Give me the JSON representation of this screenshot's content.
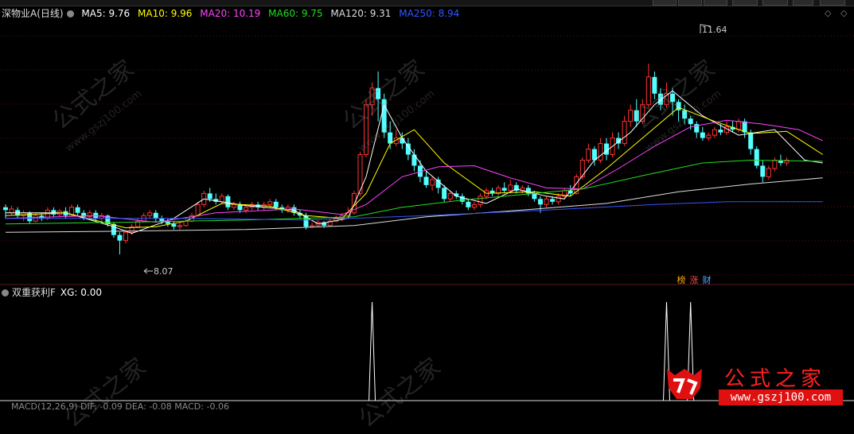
{
  "stock_legend": {
    "name": "深物业A(日线)",
    "ma": [
      {
        "label": "MA5: 9.76",
        "color": "#ffffff"
      },
      {
        "label": "MA10: 9.96",
        "color": "#ffff00"
      },
      {
        "label": "MA20: 10.19",
        "color": "#ff44ff"
      },
      {
        "label": "MA60: 9.75",
        "color": "#22dd22"
      },
      {
        "label": "MA120: 9.31",
        "color": "#dddddd"
      },
      {
        "label": "MA250: 8.94",
        "color": "#3355ff"
      }
    ]
  },
  "indicator_legend": {
    "name": "双重获利F",
    "value": "XG: 0.00"
  },
  "macd_legend": {
    "text": "MACD(12,26,9)  DIF: -0.09  DEA: -0.08  MACD: -0.06"
  },
  "price_annotations": {
    "high": "11.64",
    "low": "8.07"
  },
  "badges": [
    {
      "char": "榜",
      "color": "#ffaa00"
    },
    {
      "char": "涨",
      "color": "#ff4444"
    },
    {
      "char": "财",
      "color": "#55aaff"
    }
  ],
  "logo": {
    "title": "公式之家",
    "url": "www.gszj100.com"
  },
  "watermark": {
    "title": "公式之家",
    "url": "www.gszj100.com"
  },
  "colors": {
    "up": "#ff3232",
    "down": "#54ffff",
    "background": "#000000"
  },
  "chart_data": {
    "type": "candlestick",
    "price_range": [
      7.8,
      12.1
    ],
    "candles": [
      [
        9.05,
        9.0,
        9.1,
        8.85
      ],
      [
        8.95,
        9.02,
        9.08,
        8.9
      ],
      [
        9.0,
        8.9,
        9.05,
        8.85
      ],
      [
        8.9,
        8.95,
        9.0,
        8.8
      ],
      [
        8.95,
        8.8,
        8.98,
        8.75
      ],
      [
        8.8,
        8.9,
        8.95,
        8.78
      ],
      [
        8.9,
        8.85,
        8.95,
        8.8
      ],
      [
        8.85,
        9.0,
        9.05,
        8.82
      ],
      [
        9.0,
        8.92,
        9.05,
        8.88
      ],
      [
        8.92,
        8.98,
        9.02,
        8.88
      ],
      [
        8.98,
        8.9,
        9.05,
        8.85
      ],
      [
        8.9,
        9.05,
        9.1,
        8.88
      ],
      [
        9.05,
        8.95,
        9.1,
        8.9
      ],
      [
        8.95,
        8.88,
        9.0,
        8.82
      ],
      [
        8.88,
        8.95,
        9.0,
        8.85
      ],
      [
        8.95,
        8.85,
        9.0,
        8.8
      ],
      [
        8.85,
        8.9,
        8.95,
        8.8
      ],
      [
        8.9,
        8.75,
        8.92,
        8.7
      ],
      [
        8.75,
        8.55,
        8.78,
        8.5
      ],
      [
        8.55,
        8.45,
        8.6,
        8.2
      ],
      [
        8.45,
        8.6,
        8.65,
        8.4
      ],
      [
        8.6,
        8.7,
        8.75,
        8.55
      ],
      [
        8.7,
        8.8,
        8.85,
        8.68
      ],
      [
        8.8,
        8.9,
        8.95,
        8.78
      ],
      [
        8.9,
        8.95,
        9.0,
        8.85
      ],
      [
        8.95,
        8.85,
        9.0,
        8.8
      ],
      [
        8.85,
        8.8,
        8.9,
        8.75
      ],
      [
        8.8,
        8.75,
        8.85,
        8.7
      ],
      [
        8.75,
        8.7,
        8.8,
        8.65
      ],
      [
        8.7,
        8.72,
        8.78,
        8.65
      ],
      [
        8.72,
        8.8,
        8.85,
        8.7
      ],
      [
        8.8,
        8.9,
        8.95,
        8.78
      ],
      [
        8.9,
        9.1,
        9.15,
        8.88
      ],
      [
        9.1,
        9.3,
        9.35,
        9.05
      ],
      [
        9.3,
        9.2,
        9.4,
        9.15
      ],
      [
        9.2,
        9.15,
        9.3,
        9.1
      ],
      [
        9.15,
        9.25,
        9.3,
        9.1
      ],
      [
        9.25,
        9.05,
        9.28,
        9.0
      ],
      [
        9.05,
        9.1,
        9.15,
        9.0
      ],
      [
        9.1,
        9.0,
        9.15,
        8.95
      ],
      [
        9.0,
        9.05,
        9.1,
        8.95
      ],
      [
        9.05,
        9.1,
        9.15,
        9.0
      ],
      [
        9.1,
        9.05,
        9.15,
        9.0
      ],
      [
        9.05,
        9.1,
        9.15,
        9.0
      ],
      [
        9.1,
        9.15,
        9.2,
        9.05
      ],
      [
        9.15,
        9.05,
        9.2,
        9.0
      ],
      [
        9.05,
        9.0,
        9.1,
        8.95
      ],
      [
        9.0,
        9.05,
        9.1,
        8.95
      ],
      [
        9.05,
        8.95,
        9.1,
        8.9
      ],
      [
        8.95,
        8.9,
        9.0,
        8.85
      ],
      [
        8.9,
        8.7,
        8.95,
        8.65
      ],
      [
        8.7,
        8.72,
        8.78,
        8.68
      ],
      [
        8.72,
        8.78,
        8.82,
        8.7
      ],
      [
        8.78,
        8.72,
        8.8,
        8.68
      ],
      [
        8.72,
        8.8,
        8.85,
        8.7
      ],
      [
        8.8,
        8.85,
        8.9,
        8.78
      ],
      [
        8.85,
        8.9,
        8.95,
        8.8
      ],
      [
        8.9,
        8.95,
        9.05,
        8.88
      ],
      [
        8.95,
        9.3,
        9.35,
        8.92
      ],
      [
        9.3,
        10.0,
        10.05,
        9.25
      ],
      [
        10.0,
        10.9,
        11.0,
        9.95
      ],
      [
        10.9,
        11.2,
        11.3,
        10.7
      ],
      [
        11.2,
        11.0,
        11.5,
        10.6
      ],
      [
        11.0,
        10.4,
        11.1,
        10.3
      ],
      [
        10.4,
        10.2,
        10.6,
        10.1
      ],
      [
        10.2,
        10.3,
        10.45,
        10.15
      ],
      [
        10.3,
        10.2,
        10.4,
        10.1
      ],
      [
        10.2,
        10.0,
        10.3,
        9.9
      ],
      [
        10.0,
        9.8,
        10.1,
        9.7
      ],
      [
        9.8,
        9.6,
        9.9,
        9.5
      ],
      [
        9.6,
        9.45,
        9.7,
        9.4
      ],
      [
        9.45,
        9.55,
        9.6,
        9.35
      ],
      [
        9.55,
        9.4,
        9.6,
        9.3
      ],
      [
        9.4,
        9.2,
        9.45,
        9.15
      ],
      [
        9.2,
        9.3,
        9.35,
        9.15
      ],
      [
        9.3,
        9.25,
        9.35,
        9.2
      ],
      [
        9.25,
        9.15,
        9.3,
        9.1
      ],
      [
        9.15,
        9.05,
        9.2,
        9.0
      ],
      [
        9.05,
        9.1,
        9.15,
        9.0
      ],
      [
        9.1,
        9.25,
        9.3,
        9.05
      ],
      [
        9.25,
        9.35,
        9.4,
        9.2
      ],
      [
        9.35,
        9.3,
        9.4,
        9.25
      ],
      [
        9.3,
        9.4,
        9.45,
        9.25
      ],
      [
        9.4,
        9.35,
        9.5,
        9.3
      ],
      [
        9.35,
        9.45,
        9.55,
        9.3
      ],
      [
        9.45,
        9.35,
        9.5,
        9.3
      ],
      [
        9.35,
        9.4,
        9.45,
        9.3
      ],
      [
        9.4,
        9.3,
        9.45,
        9.25
      ],
      [
        9.3,
        9.2,
        9.35,
        9.15
      ],
      [
        9.2,
        9.1,
        9.25,
        8.95
      ],
      [
        9.1,
        9.2,
        9.25,
        9.05
      ],
      [
        9.2,
        9.15,
        9.25,
        9.1
      ],
      [
        9.15,
        9.25,
        9.3,
        9.1
      ],
      [
        9.25,
        9.35,
        9.4,
        9.2
      ],
      [
        9.35,
        9.3,
        9.45,
        9.25
      ],
      [
        9.3,
        9.6,
        9.65,
        9.28
      ],
      [
        9.6,
        9.9,
        9.95,
        9.55
      ],
      [
        9.9,
        10.1,
        10.2,
        9.85
      ],
      [
        10.1,
        9.9,
        10.15,
        9.8
      ],
      [
        9.9,
        10.2,
        10.3,
        9.85
      ],
      [
        10.2,
        10.0,
        10.3,
        9.9
      ],
      [
        10.0,
        10.3,
        10.4,
        9.95
      ],
      [
        10.3,
        10.2,
        10.4,
        10.1
      ],
      [
        10.2,
        10.6,
        10.7,
        10.15
      ],
      [
        10.6,
        10.8,
        10.9,
        10.5
      ],
      [
        10.8,
        10.6,
        11.0,
        10.5
      ],
      [
        10.6,
        10.9,
        11.0,
        10.55
      ],
      [
        10.9,
        11.4,
        11.64,
        10.85
      ],
      [
        11.4,
        11.1,
        11.5,
        11.0
      ],
      [
        11.1,
        10.9,
        11.2,
        10.8
      ],
      [
        10.9,
        11.1,
        11.3,
        10.85
      ],
      [
        11.1,
        10.95,
        11.2,
        10.7
      ],
      [
        10.95,
        10.8,
        11.0,
        10.6
      ],
      [
        10.8,
        10.65,
        10.9,
        10.55
      ],
      [
        10.65,
        10.55,
        10.7,
        10.45
      ],
      [
        10.55,
        10.4,
        10.6,
        10.3
      ],
      [
        10.4,
        10.3,
        10.5,
        10.25
      ],
      [
        10.3,
        10.35,
        10.4,
        10.25
      ],
      [
        10.35,
        10.45,
        10.5,
        10.3
      ],
      [
        10.45,
        10.4,
        10.55,
        10.35
      ],
      [
        10.4,
        10.5,
        10.6,
        10.35
      ],
      [
        10.5,
        10.45,
        10.6,
        10.4
      ],
      [
        10.45,
        10.6,
        10.65,
        10.4
      ],
      [
        10.6,
        10.4,
        10.65,
        10.3
      ],
      [
        10.4,
        10.1,
        10.45,
        10.0
      ],
      [
        10.1,
        9.8,
        10.15,
        9.75
      ],
      [
        9.8,
        9.6,
        9.9,
        9.5
      ],
      [
        9.6,
        9.75,
        9.8,
        9.55
      ],
      [
        9.75,
        9.9,
        9.95,
        9.7
      ],
      [
        9.9,
        9.85,
        10.0,
        9.8
      ],
      [
        9.85,
        9.9,
        9.95,
        9.8
      ]
    ],
    "ma_series": [
      {
        "name": "MA5",
        "color": "#ffffff",
        "values": [
          [
            0,
            8.95
          ],
          [
            10,
            8.95
          ],
          [
            18,
            8.7
          ],
          [
            21,
            8.58
          ],
          [
            28,
            8.85
          ],
          [
            33,
            9.2
          ],
          [
            40,
            9.08
          ],
          [
            48,
            9.0
          ],
          [
            52,
            8.75
          ],
          [
            57,
            8.85
          ],
          [
            60,
            9.6
          ],
          [
            63,
            10.9
          ],
          [
            66,
            10.3
          ],
          [
            70,
            9.7
          ],
          [
            75,
            9.25
          ],
          [
            80,
            9.12
          ],
          [
            85,
            9.38
          ],
          [
            90,
            9.25
          ],
          [
            93,
            9.2
          ],
          [
            98,
            9.9
          ],
          [
            104,
            10.4
          ],
          [
            108,
            10.9
          ],
          [
            111,
            11.15
          ],
          [
            116,
            10.7
          ],
          [
            122,
            10.35
          ],
          [
            128,
            10.45
          ],
          [
            133,
            9.9
          ],
          [
            136,
            9.85
          ]
        ]
      },
      {
        "name": "MA10",
        "color": "#ffff00",
        "values": [
          [
            0,
            8.9
          ],
          [
            10,
            8.95
          ],
          [
            20,
            8.68
          ],
          [
            25,
            8.7
          ],
          [
            30,
            8.8
          ],
          [
            36,
            9.12
          ],
          [
            44,
            9.07
          ],
          [
            50,
            8.9
          ],
          [
            56,
            8.85
          ],
          [
            60,
            9.3
          ],
          [
            64,
            10.2
          ],
          [
            68,
            10.45
          ],
          [
            73,
            9.85
          ],
          [
            80,
            9.3
          ],
          [
            88,
            9.33
          ],
          [
            94,
            9.25
          ],
          [
            100,
            9.75
          ],
          [
            106,
            10.3
          ],
          [
            112,
            10.85
          ],
          [
            118,
            10.6
          ],
          [
            124,
            10.38
          ],
          [
            130,
            10.42
          ],
          [
            136,
            10.0
          ]
        ]
      },
      {
        "name": "MA20",
        "color": "#ff44ff",
        "values": [
          [
            0,
            8.85
          ],
          [
            15,
            8.9
          ],
          [
            25,
            8.78
          ],
          [
            35,
            8.95
          ],
          [
            48,
            9.02
          ],
          [
            56,
            8.92
          ],
          [
            60,
            9.1
          ],
          [
            66,
            9.6
          ],
          [
            72,
            9.78
          ],
          [
            78,
            9.8
          ],
          [
            84,
            9.58
          ],
          [
            90,
            9.4
          ],
          [
            96,
            9.38
          ],
          [
            102,
            9.75
          ],
          [
            108,
            10.15
          ],
          [
            114,
            10.5
          ],
          [
            120,
            10.62
          ],
          [
            126,
            10.55
          ],
          [
            132,
            10.45
          ],
          [
            136,
            10.25
          ]
        ]
      },
      {
        "name": "MA60",
        "color": "#22dd22",
        "values": [
          [
            0,
            8.75
          ],
          [
            20,
            8.78
          ],
          [
            40,
            8.82
          ],
          [
            58,
            8.88
          ],
          [
            66,
            9.05
          ],
          [
            76,
            9.18
          ],
          [
            86,
            9.28
          ],
          [
            96,
            9.38
          ],
          [
            106,
            9.62
          ],
          [
            116,
            9.85
          ],
          [
            124,
            9.9
          ],
          [
            136,
            9.88
          ]
        ]
      },
      {
        "name": "MA120",
        "color": "#dddddd",
        "values": [
          [
            0,
            8.6
          ],
          [
            20,
            8.62
          ],
          [
            40,
            8.65
          ],
          [
            58,
            8.72
          ],
          [
            70,
            8.88
          ],
          [
            86,
            9.0
          ],
          [
            100,
            9.12
          ],
          [
            112,
            9.33
          ],
          [
            124,
            9.47
          ],
          [
            136,
            9.58
          ]
        ]
      },
      {
        "name": "MA250",
        "color": "#3355ff",
        "values": [
          [
            0,
            8.85
          ],
          [
            30,
            8.85
          ],
          [
            50,
            8.82
          ],
          [
            70,
            8.9
          ],
          [
            90,
            9.0
          ],
          [
            108,
            9.1
          ],
          [
            120,
            9.15
          ],
          [
            136,
            9.15
          ]
        ]
      }
    ],
    "signal_spikes": [
      61,
      110,
      114
    ]
  }
}
